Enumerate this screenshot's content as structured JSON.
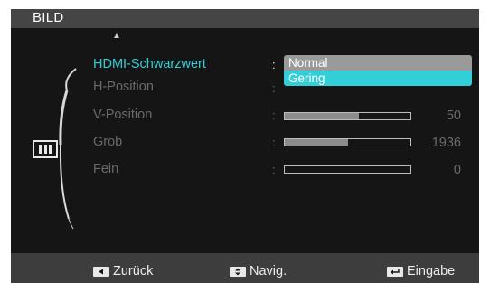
{
  "header": {
    "title": "BILD"
  },
  "menu": {
    "items": [
      {
        "label": "HDMI-Schwarzwert",
        "separator": ":",
        "active": true
      },
      {
        "label": "H-Position",
        "separator": ":"
      },
      {
        "label": "V-Position",
        "separator": ":",
        "value": "50",
        "level": 0.59
      },
      {
        "label": "Grob",
        "separator": ":",
        "value": "1936",
        "level": 0.5
      },
      {
        "label": "Fein",
        "separator": ":",
        "value": "0",
        "level": 0.0
      }
    ]
  },
  "dropdown": {
    "options": [
      "Normal",
      "Gering"
    ],
    "selected": "Gering"
  },
  "footer": {
    "back_label": "Zurück",
    "nav_label": "Navig.",
    "enter_label": "Eingabe"
  },
  "icons": {
    "category": "picture-category-icon",
    "scroll_up": "scroll-up-icon",
    "back": "left-arrow-key-icon",
    "nav": "up-down-key-icon",
    "enter": "enter-key-icon"
  },
  "colors": {
    "accent": "#33cfd8",
    "selected_option": "#33cfd8",
    "unselected_option": "#9a9a9a",
    "osd_background": "#151515",
    "title_bar": "#454545",
    "footer_bar": "#3d3d3d",
    "bar_fill": "#8c8c8c",
    "dim_text": "#6a6a6a"
  }
}
